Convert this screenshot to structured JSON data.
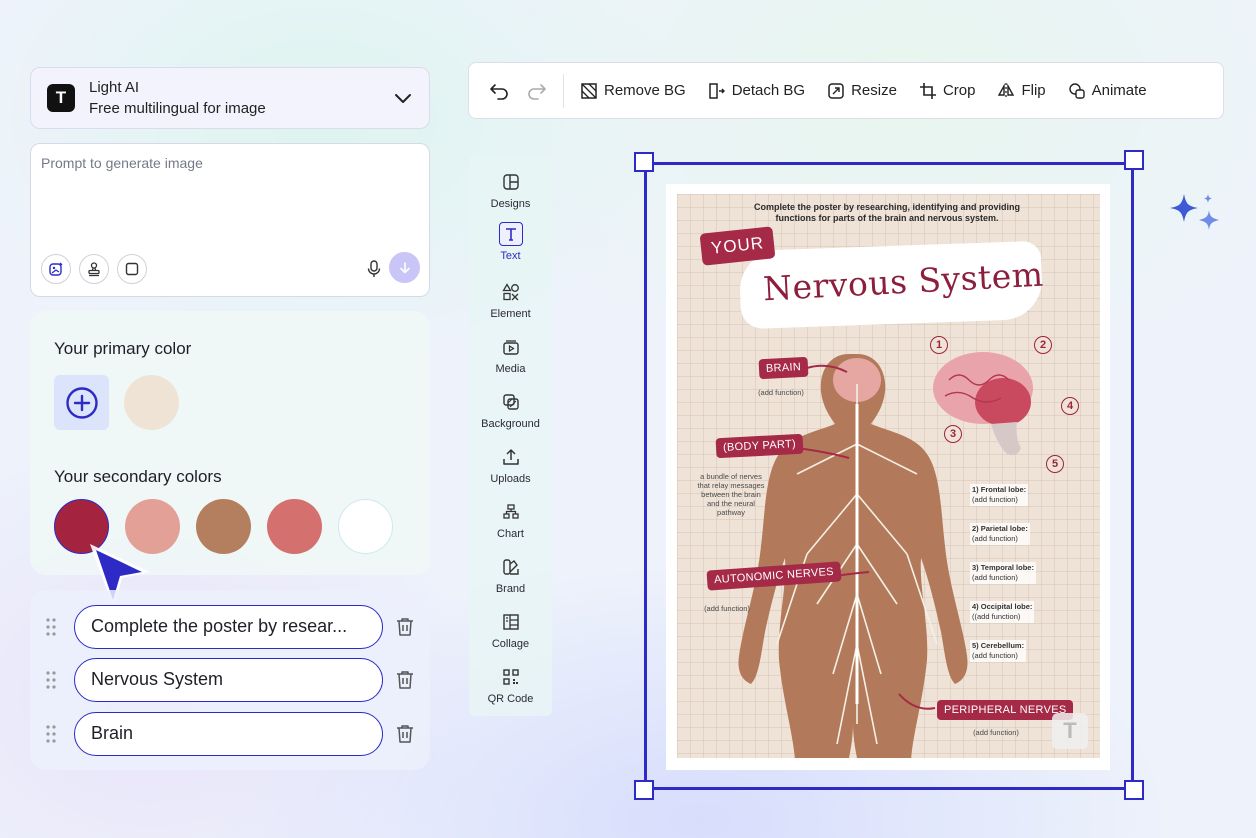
{
  "model": {
    "name": "Light AI",
    "description": "Free multilingual for image",
    "logo_letter": "T"
  },
  "prompt": {
    "placeholder": "Prompt to generate image"
  },
  "colors": {
    "primary_title": "Your primary color",
    "primary": [
      "#efe3d6"
    ],
    "secondary_title": "Your secondary colors",
    "secondary": [
      "#a4243f",
      "#e2a097",
      "#b47f5f",
      "#d4706e",
      "#ffffff"
    ],
    "accent": "#2e2ac6"
  },
  "text_items": [
    {
      "value": "Complete the poster by resear..."
    },
    {
      "value": "Nervous System"
    },
    {
      "value": "Brain"
    }
  ],
  "toolbar": {
    "remove_bg": "Remove BG",
    "detach_bg": "Detach BG",
    "resize": "Resize",
    "crop": "Crop",
    "flip": "Flip",
    "animate": "Animate"
  },
  "sidebar": [
    {
      "label": "Designs",
      "icon": "designs-icon"
    },
    {
      "label": "Text",
      "icon": "text-icon",
      "active": true
    },
    {
      "label": "Element",
      "icon": "element-icon"
    },
    {
      "label": "Media",
      "icon": "media-icon"
    },
    {
      "label": "Background",
      "icon": "background-icon"
    },
    {
      "label": "Uploads",
      "icon": "upload-icon"
    },
    {
      "label": "Chart",
      "icon": "chart-icon"
    },
    {
      "label": "Brand",
      "icon": "brand-icon"
    },
    {
      "label": "Collage",
      "icon": "collage-icon"
    },
    {
      "label": "QR Code",
      "icon": "qr-code-icon"
    }
  ],
  "poster": {
    "instructions": "Complete the poster by researching, identifying and providing functions for parts of the brain and nervous system.",
    "your": "YOUR",
    "title": "Nervous System",
    "brain": "BRAIN",
    "brain_note": "(add function)",
    "body_part": "(BODY PART)",
    "body_part_note": "a bundle of nerves that relay messages between the brain and the neural pathway",
    "autonomic": "AUTONOMIC NERVES",
    "autonomic_note": "(add function)",
    "peripheral": "PERIPHERAL NERVES",
    "peripheral_note": "(add function)",
    "lobes": [
      {
        "name": "1) Frontal lobe:",
        "fn": "(add function)"
      },
      {
        "name": "2) Parietal lobe:",
        "fn": "(add function)"
      },
      {
        "name": "3) Temporal lobe:",
        "fn": "(add function)"
      },
      {
        "name": "4) Occipital lobe:",
        "fn": "((add function)"
      },
      {
        "name": "5) Cerebellum:",
        "fn": "(add function)"
      }
    ],
    "numbers": [
      "1",
      "2",
      "3",
      "4",
      "5"
    ],
    "watermark": "T"
  }
}
